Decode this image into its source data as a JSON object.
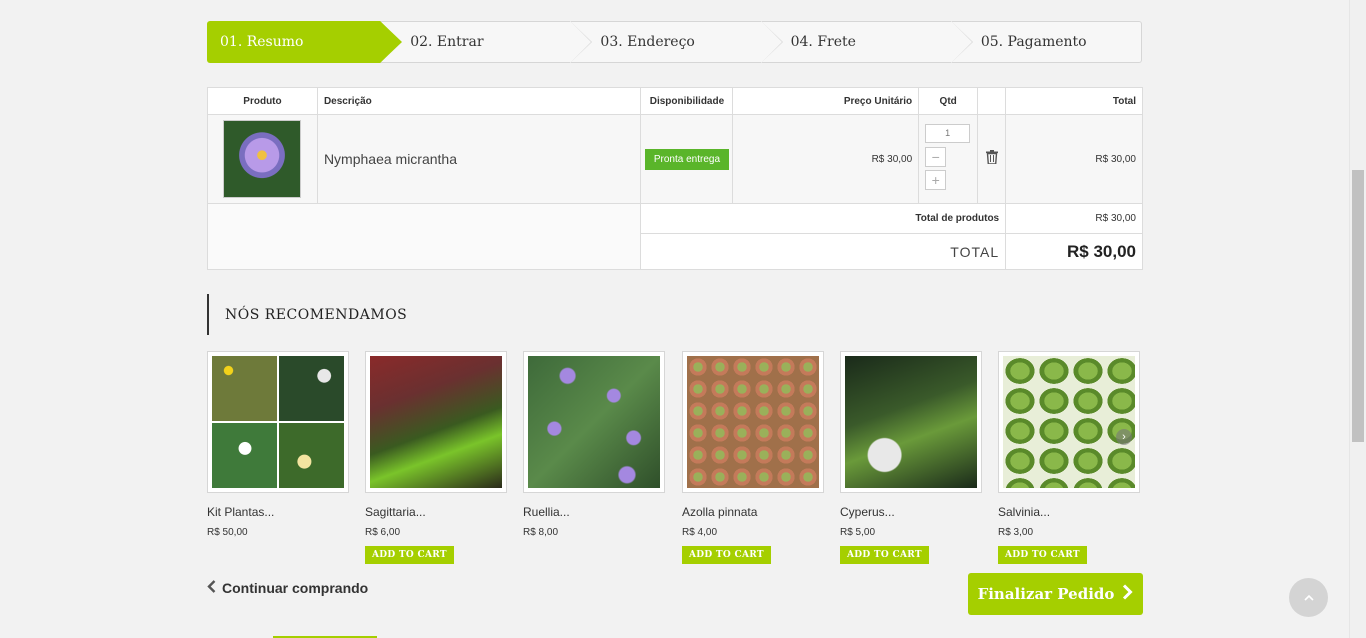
{
  "steps": [
    {
      "label": "01. Resumo"
    },
    {
      "label": "02. Entrar"
    },
    {
      "label": "03. Endereço"
    },
    {
      "label": "04. Frete"
    },
    {
      "label": "05. Pagamento"
    }
  ],
  "cart": {
    "headers": {
      "produto": "Produto",
      "descricao": "Descrição",
      "disponibilidade": "Disponibilidade",
      "preco": "Preço Unitário",
      "qtd": "Qtd",
      "total": "Total"
    },
    "item": {
      "name": "Nymphaea micrantha",
      "availability": "Pronta entrega",
      "unit_price": "R$ 30,00",
      "qty": "1",
      "minus": "−",
      "plus": "+",
      "total": "R$ 30,00"
    },
    "summary": {
      "products_label": "Total de produtos",
      "products_value": "R$ 30,00",
      "total_label": "TOTAL",
      "total_value": "R$ 30,00"
    }
  },
  "recommend": {
    "title": "NÓS RECOMENDAMOS",
    "add_label": "ADD TO CART",
    "products": [
      {
        "name": "Kit Plantas...",
        "price": "R$ 50,00",
        "has_button": false
      },
      {
        "name": "Sagittaria...",
        "price": "R$ 6,00",
        "has_button": true
      },
      {
        "name": "Ruellia...",
        "price": "R$ 8,00",
        "has_button": false
      },
      {
        "name": "Azolla pinnata",
        "price": "R$ 4,00",
        "has_button": true
      },
      {
        "name": "Cyperus...",
        "price": "R$ 5,00",
        "has_button": true
      },
      {
        "name": "Salvinia...",
        "price": "R$ 3,00",
        "has_button": true
      }
    ]
  },
  "actions": {
    "continue": "Continuar comprando",
    "finish": "Finalizar Pedido"
  },
  "colors": {
    "accent": "#a5cf00",
    "available": "#5ab52a"
  }
}
